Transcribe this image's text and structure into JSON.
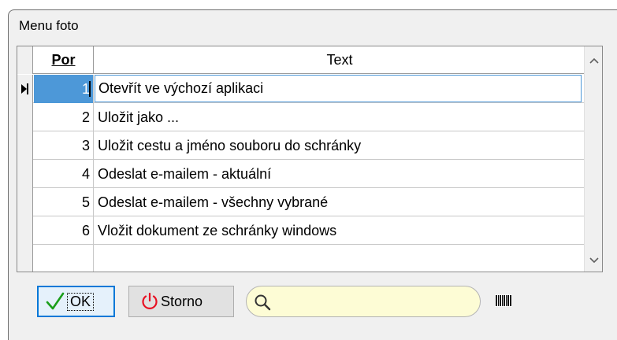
{
  "window": {
    "title": "Menu foto"
  },
  "grid": {
    "columns": {
      "por": "Por",
      "text": "Text"
    },
    "rows": [
      {
        "por": "1",
        "text": "Otevřít ve výchozí aplikaci"
      },
      {
        "por": "2",
        "text": "Uložit jako ..."
      },
      {
        "por": "3",
        "text": "Uložit cestu a jméno souboru do schránky"
      },
      {
        "por": "4",
        "text": "Odeslat e-mailem - aktuální"
      },
      {
        "por": "5",
        "text": "Odeslat e-mailem - všechny vybrané"
      },
      {
        "por": "6",
        "text": "Vložit dokument ze schránky windows"
      },
      {
        "por": "",
        "text": ""
      }
    ],
    "selected_row": "1"
  },
  "buttons": {
    "ok": "OK",
    "storno": "Storno"
  },
  "search": {
    "value": "",
    "placeholder": ""
  },
  "icons": {
    "ok": "checkmark-icon",
    "storno": "power-icon",
    "search": "search-icon",
    "barcode": "barcode-icon",
    "scroll_up": "chevron-up-icon",
    "scroll_down": "chevron-down-icon",
    "row_pointer": "row-pointer-icon"
  },
  "colors": {
    "selection": "#4d98d8",
    "ok_check": "#1a9e1a",
    "storno_power": "#e81123",
    "search_bg": "#fdfcd5"
  }
}
